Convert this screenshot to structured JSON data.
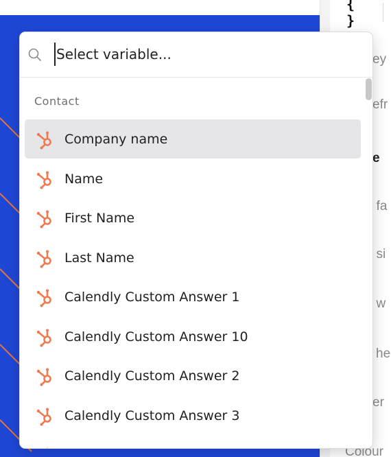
{
  "toolbar": {
    "variable_button_label": "{ }"
  },
  "right_panel": {
    "texts": [
      {
        "text": "ey",
        "style": "muted"
      },
      {
        "text": "efr",
        "style": "muted"
      },
      {
        "text": "e",
        "style": "dark"
      },
      {
        "text": "t fa",
        "style": "muted"
      },
      {
        "text": "t si",
        "style": "muted"
      },
      {
        "text": "t w",
        "style": "muted"
      },
      {
        "text": "he",
        "style": "muted"
      },
      {
        "text": "er",
        "style": "muted"
      },
      {
        "text": "Colour",
        "style": "muted"
      }
    ]
  },
  "variable_picker": {
    "search": {
      "value": "",
      "placeholder": "Select variable..."
    },
    "section_title": "Contact",
    "items": [
      {
        "label": "Company name",
        "icon": "hubspot-icon",
        "selected": true
      },
      {
        "label": "Name",
        "icon": "hubspot-icon",
        "selected": false
      },
      {
        "label": "First Name",
        "icon": "hubspot-icon",
        "selected": false
      },
      {
        "label": "Last Name",
        "icon": "hubspot-icon",
        "selected": false
      },
      {
        "label": "Calendly Custom Answer 1",
        "icon": "hubspot-icon",
        "selected": false
      },
      {
        "label": "Calendly Custom Answer 10",
        "icon": "hubspot-icon",
        "selected": false
      },
      {
        "label": "Calendly Custom Answer 2",
        "icon": "hubspot-icon",
        "selected": false
      },
      {
        "label": "Calendly Custom Answer 3",
        "icon": "hubspot-icon",
        "selected": false
      },
      {
        "label": "",
        "icon": "hubspot-icon",
        "selected": false
      }
    ]
  },
  "colors": {
    "canvas_blue": "#1f47d6",
    "stripe_orange": "#e8743b",
    "hubspot_orange": "#f07a4f",
    "selected_row": "#e6e6e8"
  }
}
